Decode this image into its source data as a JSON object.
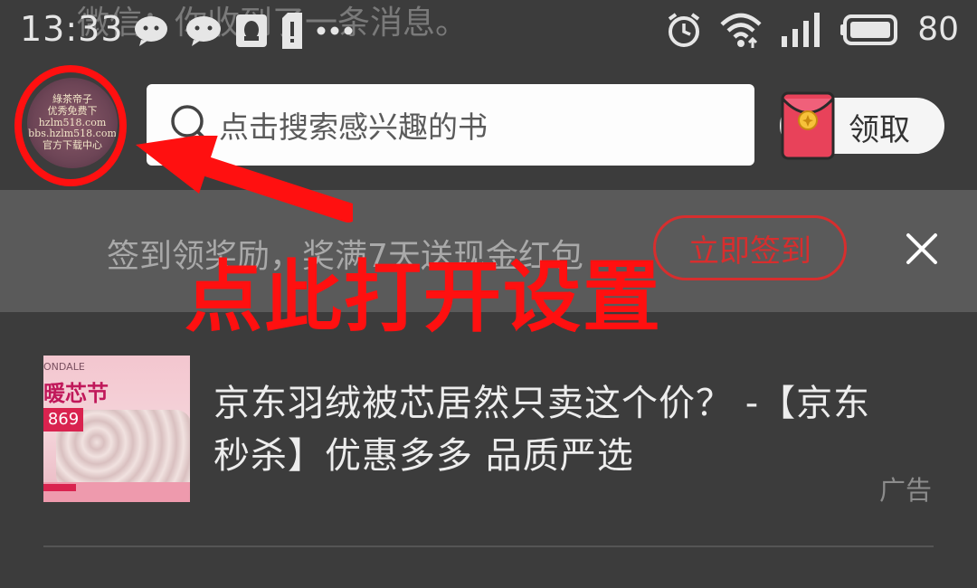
{
  "status_bar": {
    "time": "13:33",
    "notification_text": "微信：你收到了一条消息。",
    "battery_level": "80",
    "icons": [
      "wechat-icon",
      "wechat-icon",
      "qq-icon",
      "sim-alert-icon",
      "more-dots-icon",
      "alarm-icon",
      "wifi-icon",
      "signal-icon",
      "battery-icon"
    ]
  },
  "header": {
    "avatar_lines": [
      "綠茶帝子",
      "优秀免费下",
      "hzlm518.com",
      "bbs.hzlm518.com",
      "官方下载中心"
    ],
    "search": {
      "placeholder": "点击搜索感兴趣的书",
      "icon": "search-icon"
    },
    "red_packet": {
      "label": "领取",
      "icon": "red-envelope-icon"
    }
  },
  "sign_bar": {
    "text": "签到领奖励，奖满7天送现金红包",
    "button_label": "立即签到",
    "close_icon": "close-icon"
  },
  "annotation": {
    "text": "点此打开设置",
    "color": "#ff1010"
  },
  "feed": [
    {
      "thumbnail": {
        "brand": "ONDALE",
        "title": "暖芯节",
        "price": "869"
      },
      "title": "京东羽绒被芯居然只卖这个价？ -【京东秒杀】优惠多多  品质严选",
      "badge": "广告"
    }
  ],
  "colors": {
    "background": "#3c3c3c",
    "sign_bar": "#5a5a5a",
    "accent_red": "#d72e2e"
  }
}
